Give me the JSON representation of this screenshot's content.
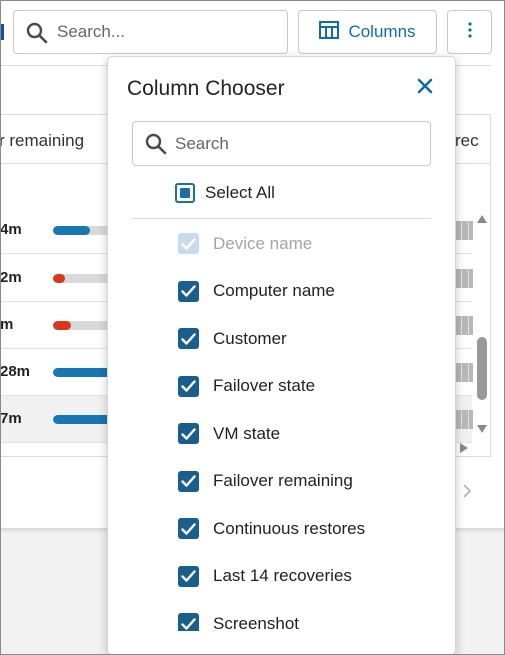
{
  "toolbar": {
    "search_placeholder": "Search...",
    "columns_label": "Columns"
  },
  "grid": {
    "header_left": "r remaining",
    "header_right": "rec",
    "rows": [
      {
        "time": "4m",
        "progress": 0.62,
        "color": "#1876b2"
      },
      {
        "time": "2m",
        "progress": 0.2,
        "color": "#d7381c"
      },
      {
        "time": "m",
        "progress": 0.3,
        "color": "#d7381c"
      },
      {
        "time": "28m",
        "progress": 1.0,
        "color": "#1876b2"
      },
      {
        "time": "7m",
        "progress": 1.0,
        "color": "#1876b2"
      }
    ]
  },
  "column_chooser": {
    "title": "Column Chooser",
    "search_placeholder": "Search",
    "select_all_label": "Select All",
    "columns": [
      {
        "label": "Device name",
        "checked": true,
        "disabled": true
      },
      {
        "label": "Computer name",
        "checked": true,
        "disabled": false
      },
      {
        "label": "Customer",
        "checked": true,
        "disabled": false
      },
      {
        "label": "Failover state",
        "checked": true,
        "disabled": false
      },
      {
        "label": "VM state",
        "checked": true,
        "disabled": false
      },
      {
        "label": "Failover remaining",
        "checked": true,
        "disabled": false
      },
      {
        "label": "Continuous restores",
        "checked": true,
        "disabled": false
      },
      {
        "label": "Last 14 recoveries",
        "checked": true,
        "disabled": false
      },
      {
        "label": "Screenshot",
        "checked": true,
        "disabled": false
      }
    ]
  },
  "colors": {
    "accent": "#0f6da8",
    "checkbox": "#1a5e8c",
    "checkbox_disabled": "#c7dbea",
    "progress_blue": "#1876b2",
    "progress_red": "#d7381c"
  }
}
